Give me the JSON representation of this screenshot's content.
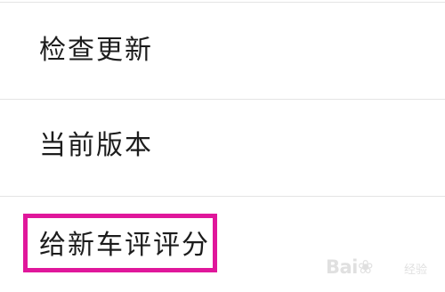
{
  "settings": {
    "items": [
      {
        "label": "检查更新"
      },
      {
        "label": "当前版本"
      },
      {
        "label": "给新车评评分"
      }
    ]
  },
  "watermark": {
    "brand": "Bai",
    "brand_mid": "du",
    "sub": "经验"
  },
  "colors": {
    "highlight": "#e0179b",
    "text": "#1c1c1c",
    "divider": "#e4e4e4"
  }
}
